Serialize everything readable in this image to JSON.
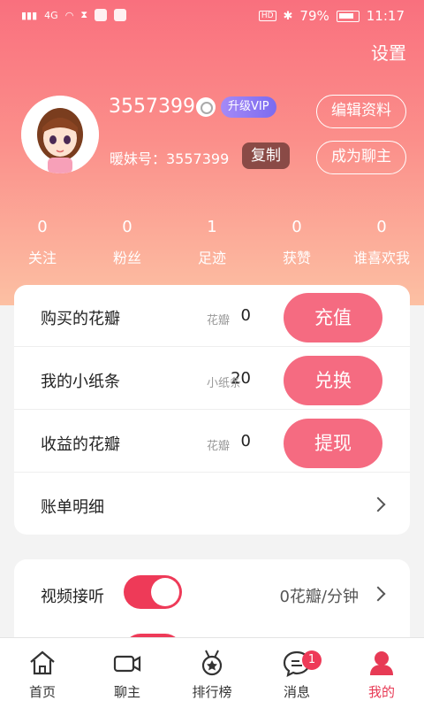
{
  "status_bar": {
    "network": "4G",
    "battery": "79%",
    "time": "11:17",
    "hd": "HD"
  },
  "header": {
    "settings_label": "设置"
  },
  "profile": {
    "username": "3557399",
    "vip_label": "升级VIP",
    "nuanmei_id": "暖妹号：3557399",
    "copy_label": "复制",
    "edit_label": "编辑资料",
    "become_host_label": "成为聊主"
  },
  "stats": [
    {
      "value": "0",
      "label": "关注"
    },
    {
      "value": "0",
      "label": "粉丝"
    },
    {
      "value": "1",
      "label": "足迹"
    },
    {
      "value": "0",
      "label": "获赞"
    },
    {
      "value": "0",
      "label": "谁喜欢我"
    }
  ],
  "wallet": [
    {
      "label": "购买的花瓣",
      "amount": "0",
      "unit": "花瓣",
      "button": "充值"
    },
    {
      "label": "我的小纸条",
      "amount": "20",
      "unit": "小纸条",
      "button": "兑换"
    },
    {
      "label": "收益的花瓣",
      "amount": "0",
      "unit": "花瓣",
      "button": "提现"
    }
  ],
  "bill_detail_label": "账单明细",
  "video_answer": {
    "label": "视频接听",
    "enabled": true,
    "rate": "0花瓣/分钟"
  },
  "tabs": [
    {
      "label": "首页",
      "icon": "home-icon"
    },
    {
      "label": "聊主",
      "icon": "video-camera-icon"
    },
    {
      "label": "排行榜",
      "icon": "medal-icon"
    },
    {
      "label": "消息",
      "icon": "message-icon",
      "badge": "1"
    },
    {
      "label": "我的",
      "icon": "profile-icon",
      "active": true
    }
  ],
  "colors": {
    "accent": "#f56b81",
    "toggle_on": "#ee3a58",
    "active_tab": "#e73a55"
  }
}
